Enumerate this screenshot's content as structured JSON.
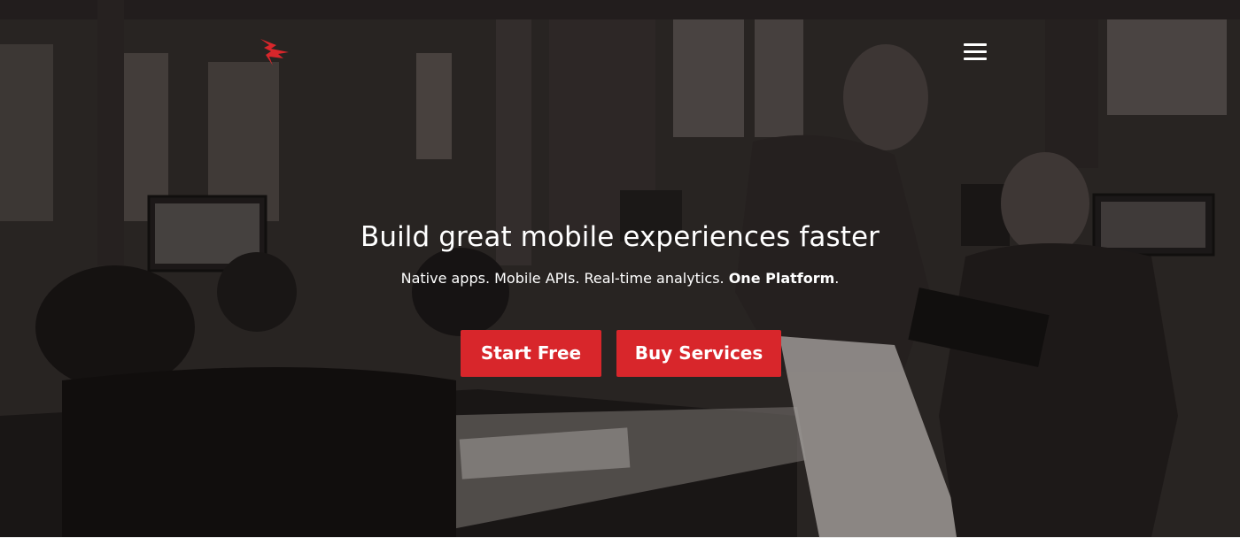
{
  "header": {
    "logo_icon": "flame-bird-logo-icon",
    "logo_color": "#d8262b",
    "menu_icon": "hamburger-menu-icon"
  },
  "hero": {
    "headline": "Build great mobile experiences faster",
    "tagline_regular": "Native apps. Mobile APIs. Real-time analytics. ",
    "tagline_bold": "One Platform",
    "tagline_end": ".",
    "background_image": "office-team-photo"
  },
  "actions": {
    "start_free_label": "Start Free",
    "buy_services_label": "Buy Services",
    "button_color": "#d8262b"
  }
}
